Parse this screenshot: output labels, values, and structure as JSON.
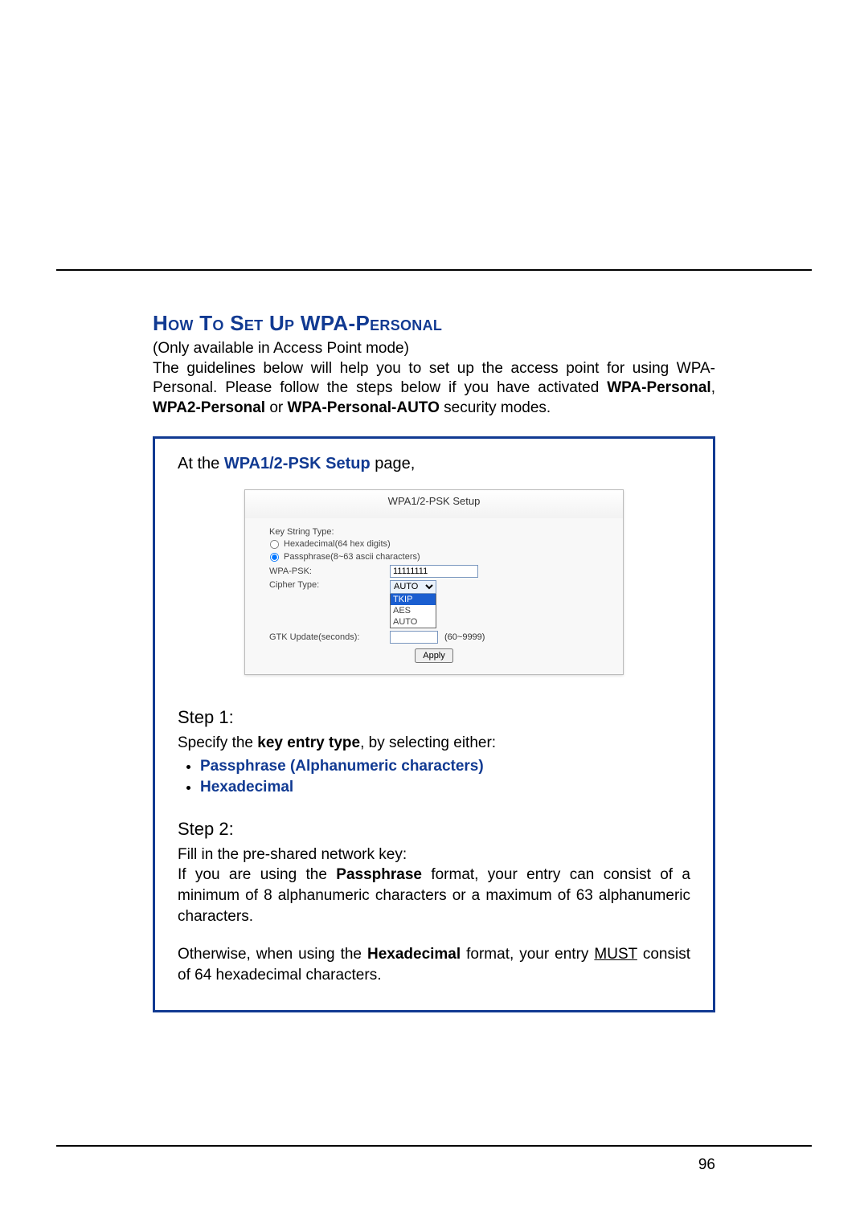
{
  "heading": "How To Set Up WPA-Personal",
  "intro": {
    "line1": "(Only available in Access Point mode)",
    "line2_a": "The guidelines below will help you to set up the access point for using WPA-Personal. Please follow the steps below if you have activated ",
    "wpa_personal": "WPA-Personal",
    "comma": ", ",
    "wpa2_personal": "WPA2-Personal",
    "or": " or ",
    "wpa_auto": "WPA-Personal-AUTO",
    "tail": " security modes."
  },
  "box": {
    "lead_a": "At the ",
    "lead_b": "WPA1/2-PSK Setup",
    "lead_c": " page,",
    "setup": {
      "title": "WPA1/2-PSK Setup",
      "key_string_type": "Key String Type:",
      "hex_option": "Hexadecimal(64 hex digits)",
      "pass_option": "Passphrase(8~63 ascii characters)",
      "wpa_psk_label": "WPA-PSK:",
      "wpa_psk_value": "11111111",
      "cipher_label": "Cipher Type:",
      "cipher_selected": "AUTO",
      "cipher_options": [
        "TKIP",
        "AES",
        "AUTO"
      ],
      "gtk_label": "GTK Update(seconds):",
      "gtk_value": "",
      "gtk_range": "(60~9999)",
      "apply": "Apply"
    },
    "step1": {
      "head": "Step 1:",
      "text_a": "Specify the ",
      "text_b": "key entry type",
      "text_c": ", by selecting either:",
      "opts": [
        "Passphrase (Alphanumeric characters)",
        "Hexadecimal"
      ]
    },
    "step2": {
      "head": "Step 2:",
      "p1_a": "Fill in the pre-shared network key:",
      "p1_b": "If you are using the ",
      "p1_c": "Passphrase",
      "p1_d": " format, your entry can consist of a minimum of 8 alphanumeric characters or a maximum of 63 alphanumeric characters.",
      "p2_a": "Otherwise, when using the ",
      "p2_b": "Hexadecimal",
      "p2_c": " format, your entry ",
      "p2_must": "MUST",
      "p2_d": " consist of 64 hexadecimal characters."
    }
  },
  "page_number": "96"
}
